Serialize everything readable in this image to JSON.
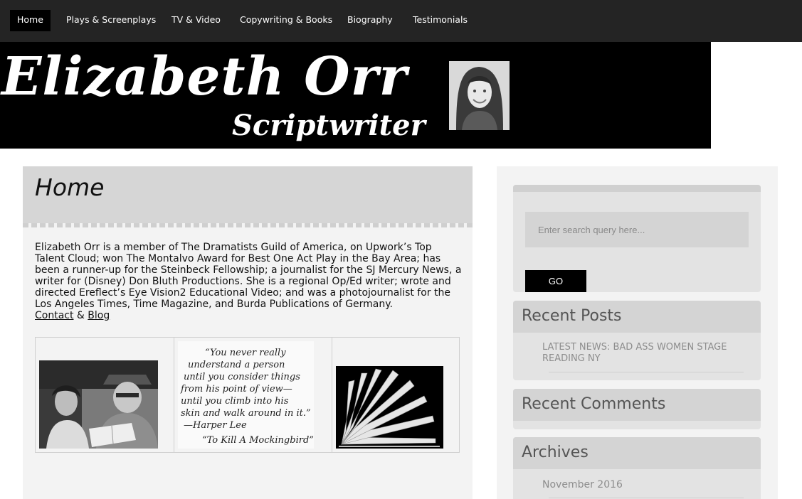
{
  "nav": {
    "items": [
      {
        "label": "Home",
        "active": true
      },
      {
        "label": "Plays & Screenplays",
        "active": false
      },
      {
        "label": "TV & Video",
        "active": false
      },
      {
        "label": "Copywriting & Books",
        "active": false
      },
      {
        "label": "Biography",
        "active": false
      },
      {
        "label": "Testimonials",
        "active": false
      }
    ]
  },
  "banner": {
    "name": "Elizabeth Orr",
    "subtitle": "Scriptwriter"
  },
  "main": {
    "title": "Home",
    "intro": "Elizabeth Orr is a member of The Dramatists Guild of America, on Upwork’s Top Talent Cloud; won The Montalvo Award for Best One Act Play in the Bay Area; has been a runner-up for the Steinbeck Fellowship; a journalist for the SJ Mercury News, a writer for (Disney) Don Bluth Productions. She is a regional Op/Ed writer; wrote and directed Ereflect’s Eye Vision2 Educational Video; and was a photojournalist for the Los Angeles Times, Time Magazine, and Burda Publications of Germany.",
    "contact_label": "Contact",
    "amp": "&",
    "blog_label": "Blog",
    "quote": {
      "lines": [
        "“You never really",
        "understand a person",
        "until you consider things",
        "from his point of view—",
        "until you climb into his",
        "skin and walk around in it.”",
        "—Harper Lee",
        "“To Kill A Mockingbird”"
      ]
    }
  },
  "sidebar": {
    "search_placeholder": "Enter search query here...",
    "go_label": "GO",
    "recent_posts_title": "Recent Posts",
    "recent_posts": [
      "LATEST NEWS: BAD ASS WOMEN STAGE READING NY"
    ],
    "recent_comments_title": "Recent Comments",
    "archives_title": "Archives",
    "archives": [
      "November 2016"
    ]
  }
}
